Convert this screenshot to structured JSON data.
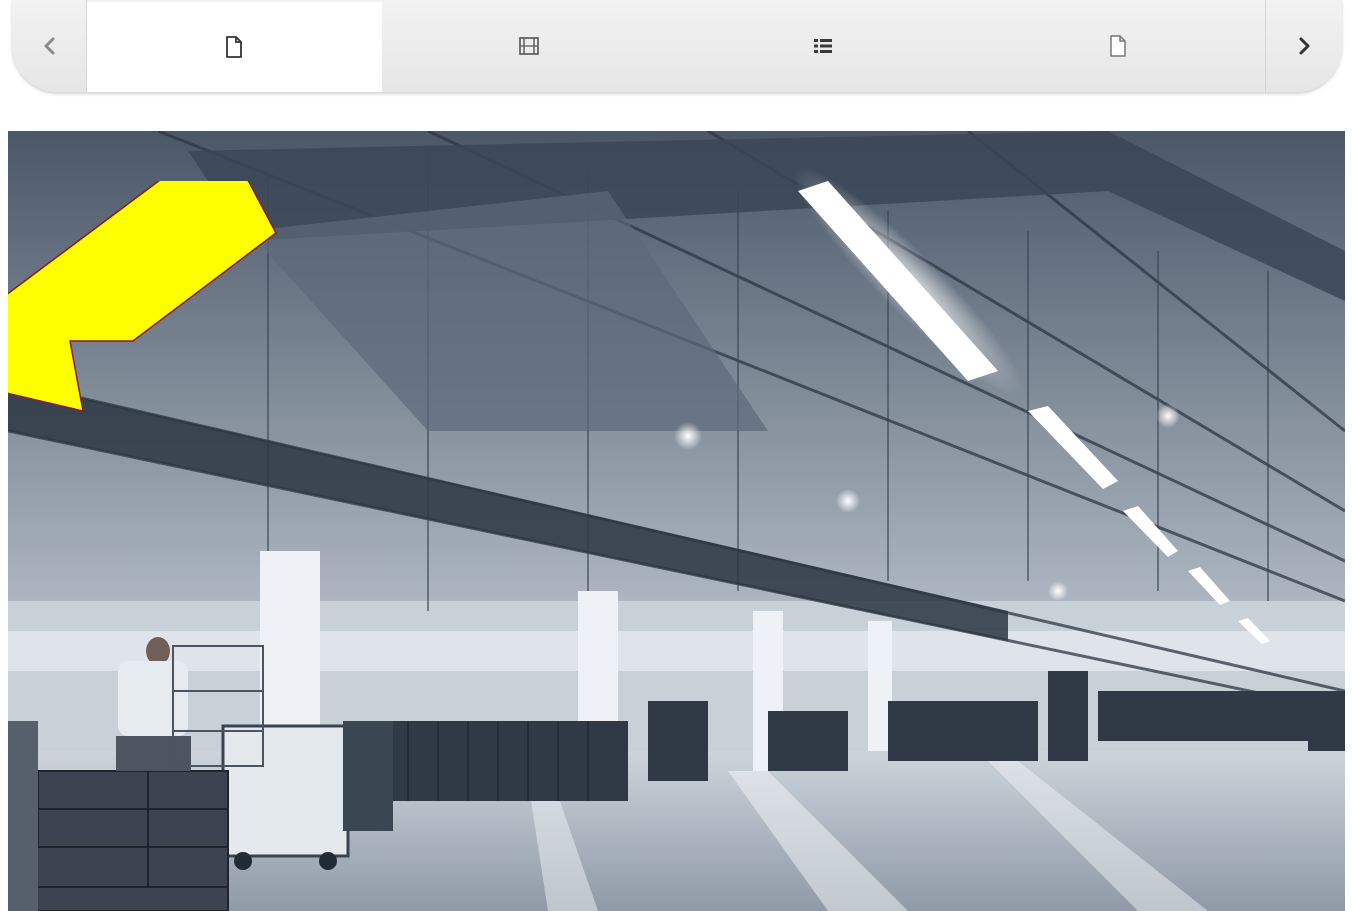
{
  "tabbar": {
    "prev_icon": "chevron-left-icon",
    "next_icon": "chevron-right-icon",
    "tabs": [
      {
        "icon": "page-icon",
        "active": true
      },
      {
        "icon": "film-icon",
        "active": false
      },
      {
        "icon": "list-icon",
        "active": false
      },
      {
        "icon": "page-icon",
        "active": false
      }
    ]
  },
  "main": {
    "image_alt": "factory-hall-photo",
    "annotation": {
      "icon": "arrow-callout",
      "color": "#ffff00",
      "stroke": "#8a1c1c"
    }
  },
  "colors": {
    "tab_bg": "#ececec",
    "tab_active_bg": "#ffffff",
    "icon": "#555555"
  }
}
